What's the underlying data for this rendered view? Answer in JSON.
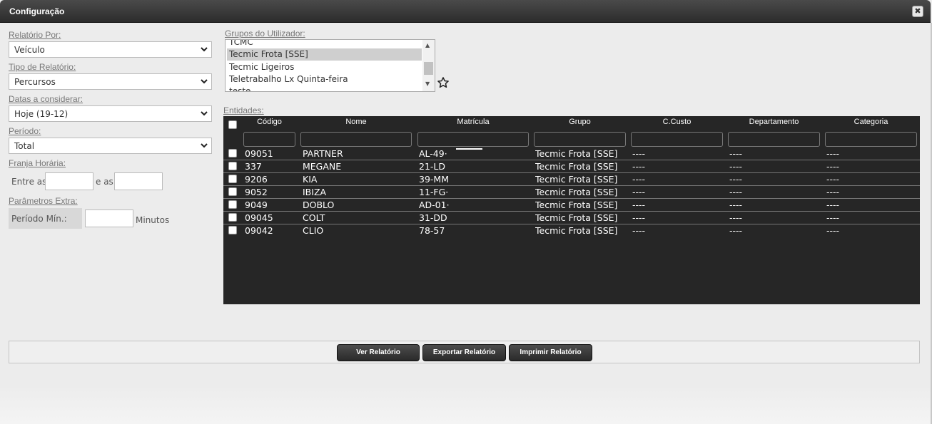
{
  "window": {
    "title": "Configuração",
    "close_symbol": "✖"
  },
  "form": {
    "relatorio_por": {
      "label": "Relatório Por:",
      "value": "Veículo"
    },
    "tipo_relatorio": {
      "label": "Tipo de Relatório:",
      "value": "Percursos"
    },
    "datas": {
      "label": "Datas a considerar:",
      "value": "Hoje (19-12)"
    },
    "periodo": {
      "label": "Período:",
      "value": "Total"
    },
    "franja": {
      "label": "Franja Horária:",
      "entre": "Entre as",
      "e_as": "e as",
      "from_value": "",
      "to_value": ""
    },
    "extra": {
      "label": "Parâmetros Extra:",
      "periodo_min": "Período Mín.:",
      "minutos": "Minutos",
      "value": ""
    }
  },
  "groups": {
    "label": "Grupos do Utilizador:",
    "items": [
      "TCMC",
      "Tecmic Frota [SSE]",
      "Tecmic Ligeiros",
      "Teletrabalho Lx Quinta-feira",
      "teste"
    ],
    "selected": "Tecmic Frota [SSE]",
    "favorite_icon": "star-outline-icon"
  },
  "entities": {
    "label": "Entidades:",
    "columns": [
      "Código",
      "Nome",
      "Matrícula",
      "Grupo",
      "C.Custo",
      "Departamento",
      "Categoria"
    ],
    "rows": [
      [
        "09051",
        "PARTNER",
        "AL-49·",
        "Tecmic Frota [SSE]",
        "----",
        "----",
        "----"
      ],
      [
        "337",
        "MEGANE",
        "21-LD",
        "Tecmic Frota [SSE]",
        "----",
        "----",
        "----"
      ],
      [
        "9206",
        "KIA",
        "39-MM",
        "Tecmic Frota [SSE]",
        "----",
        "----",
        "----"
      ],
      [
        "9052",
        "IBIZA",
        "11-FG·",
        "Tecmic Frota [SSE]",
        "----",
        "----",
        "----"
      ],
      [
        "9049",
        "DOBLO",
        "AD-01·",
        "Tecmic Frota [SSE]",
        "----",
        "----",
        "----"
      ],
      [
        "09045",
        "COLT",
        "31-DD",
        "Tecmic Frota [SSE]",
        "----",
        "----",
        "----"
      ],
      [
        "09042",
        "CLIO",
        "78-57",
        "Tecmic Frota [SSE]",
        "----",
        "----",
        "----"
      ]
    ]
  },
  "buttons": {
    "ver": "Ver Relatório",
    "exportar": "Exportar Relatório",
    "imprimir": "Imprimir Relatório"
  }
}
